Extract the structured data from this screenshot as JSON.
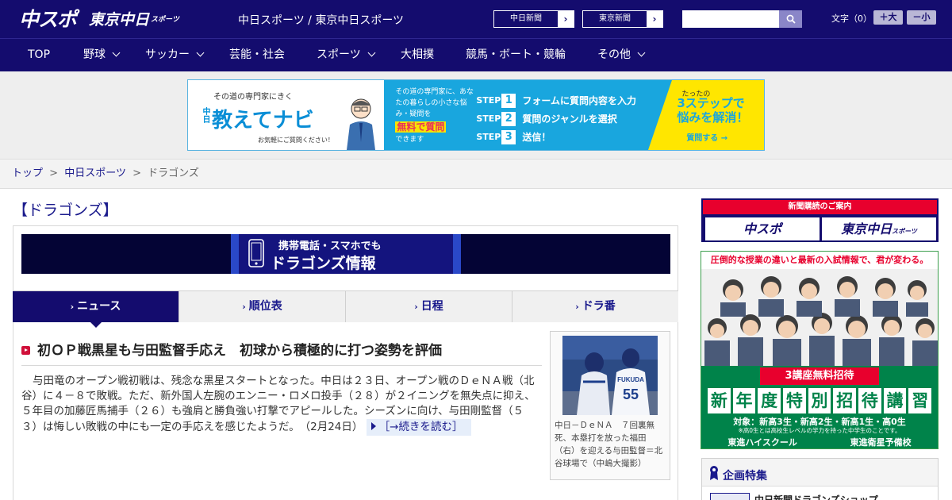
{
  "header": {
    "logo_chuspo": "中スポ",
    "logo_tokyo": "東京中日",
    "logo_tokyo_small": "スポーツ",
    "site_title": "中日スポーツ / 東京中日スポーツ",
    "newspaper_links": [
      {
        "label": "中日新聞"
      },
      {
        "label": "東京新聞"
      }
    ],
    "search_placeholder": "",
    "font_size_label": "文字（0）",
    "font_bigger": "＋大",
    "font_smaller": "－小"
  },
  "nav": {
    "items": [
      {
        "label": "TOP"
      },
      {
        "label": "野球"
      },
      {
        "label": "サッカー"
      },
      {
        "label": "芸能・社会"
      },
      {
        "label": "スポーツ"
      },
      {
        "label": "大相撲"
      },
      {
        "label": "競馬・ボート・競輪"
      },
      {
        "label": "その他"
      }
    ]
  },
  "ad_banner": {
    "left_top": "その道の専門家にきく",
    "chunichi": "中日",
    "title": "教えてナビ",
    "sub": "お気軽にご質問ください！",
    "mid_text": "その道の専門家に、あなたの暮らしの小さな悩み・疑問を",
    "mid_highlight": "無料で質問",
    "mid_end": "できます",
    "steps": [
      {
        "label": "STEP",
        "num": "1",
        "text": "フォームに質問内容を入力"
      },
      {
        "label": "STEP",
        "num": "2",
        "text": "質問のジャンルを選択"
      },
      {
        "label": "STEP",
        "num": "3",
        "text": "送信！"
      }
    ],
    "right_small": "たったの",
    "right_big1": "3ステップで",
    "right_big2": "悩みを解消！",
    "right_cta": "質問する →"
  },
  "breadcrumb": {
    "items": [
      {
        "label": "トップ"
      },
      {
        "label": "中日スポーツ"
      }
    ],
    "current": "ドラゴンズ",
    "separator": ">"
  },
  "main": {
    "page_title": "【ドラゴンズ】",
    "mobile_banner": {
      "line1": "携帯電話・スマホでも",
      "line2": "ドラゴンズ情報"
    },
    "tabs": [
      {
        "label": "ニュース",
        "active": true
      },
      {
        "label": "順位表",
        "active": false
      },
      {
        "label": "日程",
        "active": false
      },
      {
        "label": "ドラ番",
        "active": false
      }
    ],
    "article": {
      "title": "初ＯＰ戦黒星も与田監督手応え　初球から積極的に打つ姿勢を評価",
      "body": "与田竜のオープン戦初戦は、残念な黒星スタートとなった。中日は２３日、オープン戦のＤｅＮＡ戦（北谷）に４－８で敗戦。ただ、新外国人左腕のエンニー・ロメロ投手（２８）が２イニングを無失点に抑え、５年目の加藤匠馬捕手（２６）も強肩と勝負強い打撃でアピールした。シーズンに向け、与田剛監督（５３）は悔しい敗戦の中にも一定の手応えを感じたようだ。",
      "date": "（2月24日）",
      "read_more": "［→続きを読む］"
    },
    "photo": {
      "jersey_name": "FUKUDA",
      "jersey_number": "55",
      "caption": "中日－ＤｅＮＡ　７回裏無死、本塁打を放った福田（右）を迎える与田監督＝北谷球場で（中嶋大撮影）"
    }
  },
  "sidebar": {
    "subscribe": {
      "heading": "新聞購読のご案内",
      "btn1": "中スポ",
      "btn2": "東京中日",
      "btn2_small": "スポーツ"
    },
    "toshin_ad": {
      "top": "圧倒的な授業の違いと最新の入試情報で、君が変わる。",
      "free": "3講座無料招待",
      "main_chars": [
        "新",
        "年",
        "度",
        "特",
        "別",
        "招",
        "待",
        "講",
        "習"
      ],
      "target": "対象：新高3生・新高2生・新高1生・高0生",
      "note": "※高0生とは高校生レベルの学力を持った中学生のことです。",
      "brand1": "東進ハイスクール",
      "brand2": "東進衛星予備校"
    },
    "kikaku": {
      "title": "企画特集",
      "item": "中日新聞ドラゴンズショップ"
    }
  },
  "colors": {
    "brand_navy": "#140c6e",
    "accent_red": "#e8002d",
    "link_blue": "#1a1a8c",
    "toshin_green": "#00834a",
    "ad_cyan": "#19a6de",
    "ad_yellow": "#ffe600"
  },
  "icons": [
    "search-icon",
    "chevron-right-icon",
    "chevron-down-icon",
    "phone-icon",
    "ribbon-icon"
  ]
}
